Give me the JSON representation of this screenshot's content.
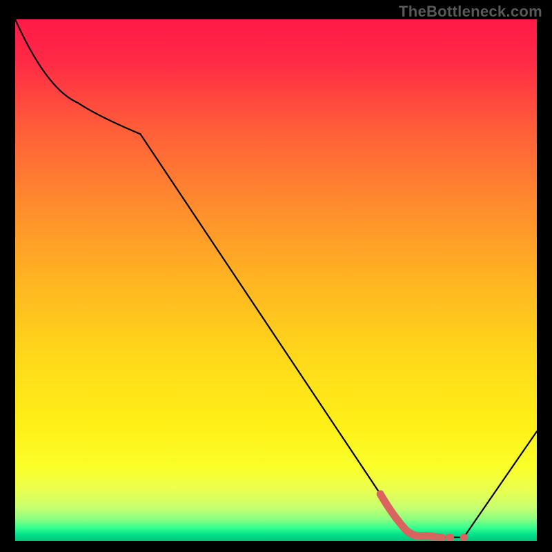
{
  "watermark": "TheBottleneck.com",
  "chart_data": {
    "type": "line",
    "title": "",
    "xlabel": "",
    "ylabel": "",
    "xlim": [
      0,
      100
    ],
    "ylim": [
      0,
      100
    ],
    "series": [
      {
        "name": "main-curve",
        "x": [
          0,
          12,
          24,
          70,
          75,
          82,
          86,
          100
        ],
        "y": [
          100,
          84,
          78,
          9,
          2,
          0.7,
          0.7,
          21
        ]
      },
      {
        "name": "highlight-segment",
        "x": [
          70,
          75,
          78,
          80,
          82,
          83.5,
          86
        ],
        "y": [
          9,
          2,
          1,
          0.9,
          0.7,
          0.7,
          0.7
        ]
      }
    ],
    "gradient_bands": [
      {
        "stop": 0.0,
        "color": "#ff1a47"
      },
      {
        "stop": 0.08,
        "color": "#ff2a46"
      },
      {
        "stop": 0.2,
        "color": "#ff5a3a"
      },
      {
        "stop": 0.35,
        "color": "#ff8a2e"
      },
      {
        "stop": 0.5,
        "color": "#ffb422"
      },
      {
        "stop": 0.65,
        "color": "#ffd91a"
      },
      {
        "stop": 0.78,
        "color": "#fff018"
      },
      {
        "stop": 0.86,
        "color": "#faff2a"
      },
      {
        "stop": 0.905,
        "color": "#e8ff52"
      },
      {
        "stop": 0.935,
        "color": "#c8ff70"
      },
      {
        "stop": 0.958,
        "color": "#8cff82"
      },
      {
        "stop": 0.975,
        "color": "#35ff90"
      },
      {
        "stop": 0.988,
        "color": "#00e08a"
      },
      {
        "stop": 1.0,
        "color": "#00c57d"
      }
    ],
    "annotations": []
  }
}
